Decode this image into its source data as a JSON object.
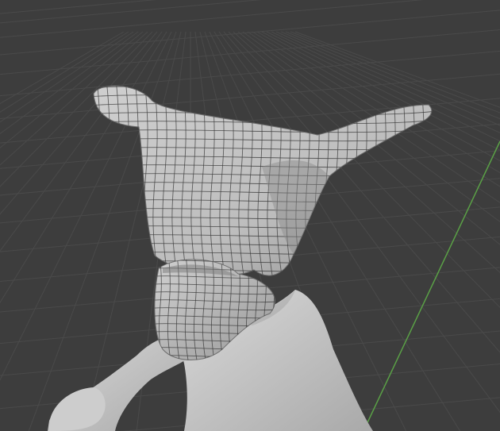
{
  "viewport": {
    "background_color": "#3d3d3d",
    "grid_color": "#4a4a4a",
    "y_axis_color": "#5aa046"
  },
  "scene": {
    "head_mesh": {
      "surface_color": "#bdbdbd",
      "wire_color": "#3a3a3a"
    },
    "body_mesh": {
      "surface_color": "#cfcfcf"
    }
  }
}
